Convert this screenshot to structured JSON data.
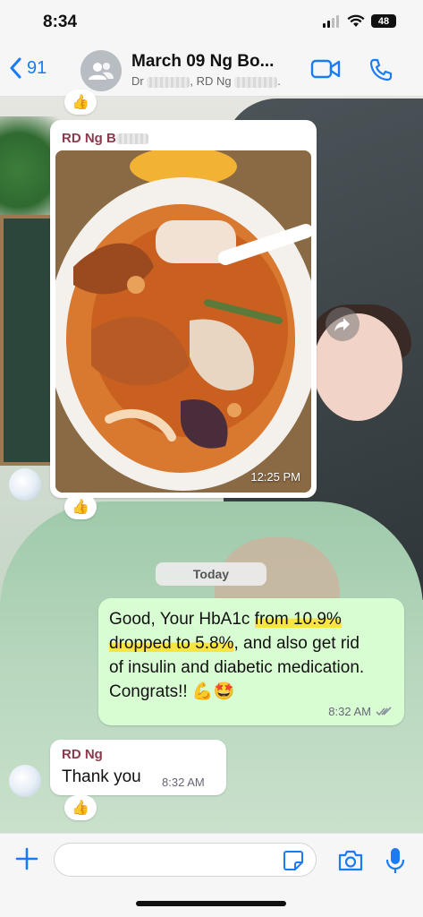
{
  "status_bar": {
    "time": "8:34",
    "battery": "48"
  },
  "header": {
    "back_count": "91",
    "title": "March 09 Ng Bo...",
    "subtitle_prefix": "Dr",
    "subtitle_mid": ", RD Ng",
    "subtitle_suffix": "."
  },
  "messages": {
    "image_msg": {
      "sender": "RD Ng B",
      "time": "12:25 PM",
      "reaction": "👍"
    },
    "first_reaction": "👍",
    "date_separator": "Today",
    "outgoing": {
      "text_start": "Good, Your HbA1c ",
      "text_highlight_1": "from 10.9%",
      "text_highlight_2": "dropped to 5.8%",
      "text_end": ", and also get rid of insulin and diabetic medication. Congrats!! 💪🤩",
      "time": "8:32 AM"
    },
    "incoming": {
      "sender": "RD Ng",
      "text": "Thank you",
      "time": "8:32 AM",
      "reaction": "👍"
    }
  },
  "input": {
    "placeholder": ""
  },
  "colors": {
    "accent": "#1a7cf5",
    "outgoing_bubble": "#d9fdd3",
    "sender_name": "#8c3b4c"
  }
}
